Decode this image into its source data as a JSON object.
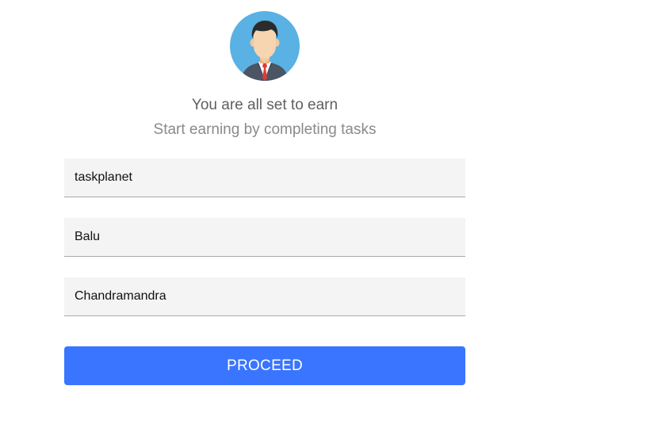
{
  "profile": {
    "avatar_icon": "businessman-avatar-icon"
  },
  "message": {
    "title": "You are all set to earn",
    "subtitle": "Start earning by completing tasks"
  },
  "form": {
    "fields": [
      {
        "value": "taskplanet"
      },
      {
        "value": "Balu"
      },
      {
        "value": "Chandramandra"
      }
    ],
    "submit_label": "PROCEED"
  },
  "colors": {
    "avatar_bg": "#5ab1e3",
    "button": "#3a75ff",
    "field_bg": "#f4f4f4"
  }
}
